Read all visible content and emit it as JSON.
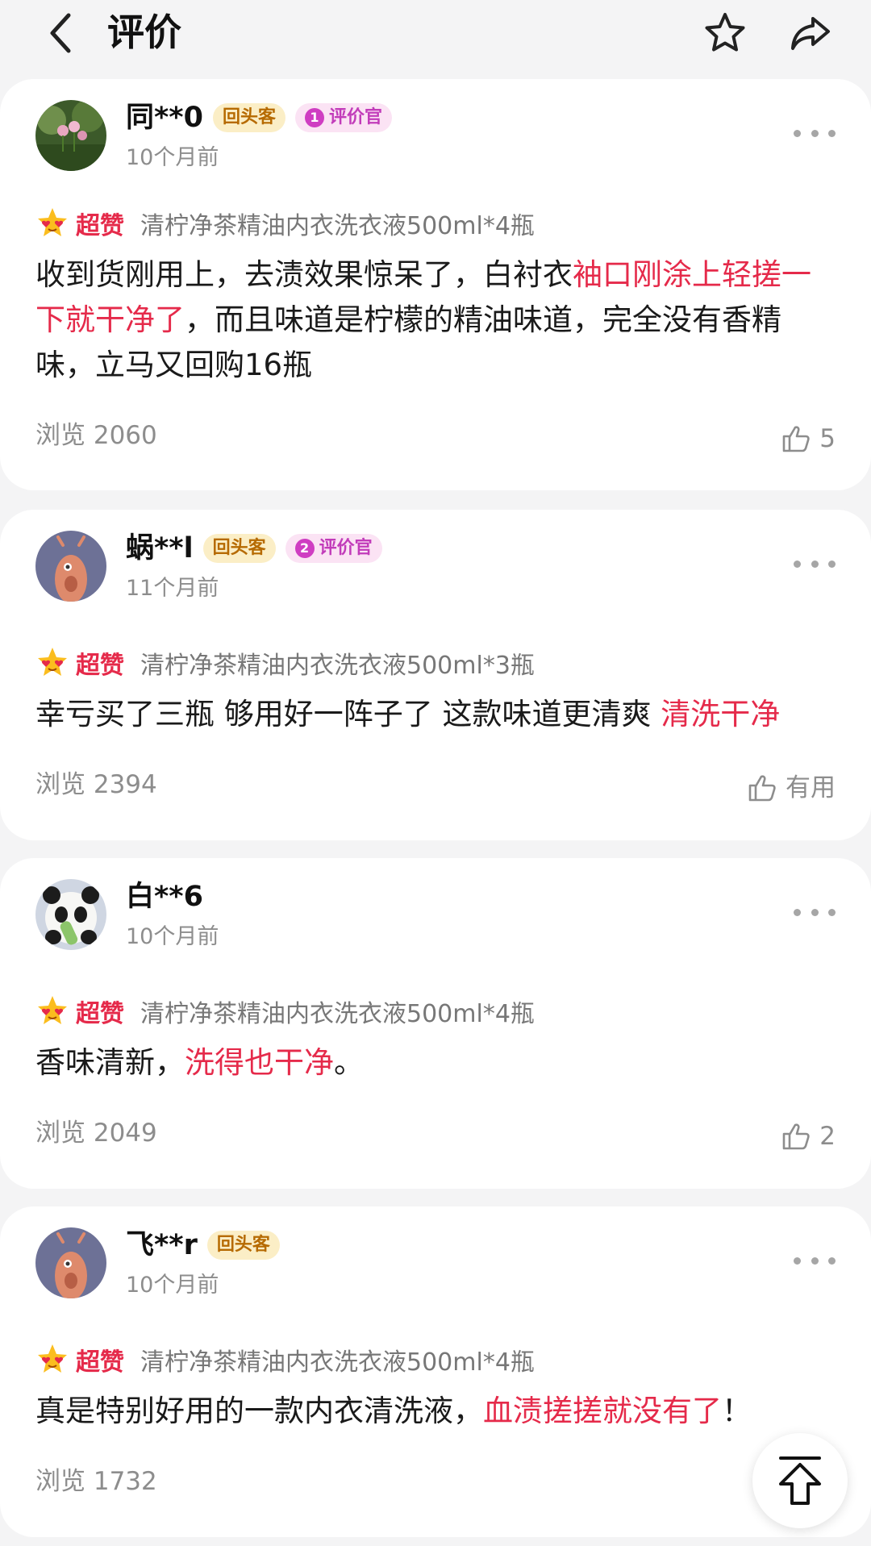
{
  "header": {
    "title": "评价",
    "back_icon": "chevron-left-icon",
    "favorite_icon": "star-icon",
    "share_icon": "share-arrow-icon"
  },
  "colors": {
    "background": "#f4f4f5",
    "highlight": "#e52a4a",
    "secondary_text": "#8d8d8d"
  },
  "reviews": [
    {
      "username": "同**0",
      "badges": {
        "returning": "回头客",
        "reviewer": "评价官",
        "reviewer_level": "1"
      },
      "time": "10个月前",
      "rating": "超赞",
      "spec": "清柠净茶精油内衣洗衣液500ml*4瓶",
      "text_parts": [
        "收到货刚用上，去渍效果惊呆了，白衬衣",
        "袖口刚涂上轻搓一下就干净了",
        "，而且味道是柠檬的精油味道，完全没有香精味，立马又回购16瓶"
      ],
      "views": "浏览 2060",
      "likes": "5"
    },
    {
      "username": "蜗**l",
      "badges": {
        "returning": "回头客",
        "reviewer": "评价官",
        "reviewer_level": "2"
      },
      "time": "11个月前",
      "rating": "超赞",
      "spec": "清柠净茶精油内衣洗衣液500ml*3瓶",
      "text_parts": [
        "幸亏买了三瓶 够用好一阵子了 这款味道更清爽 ",
        "清洗干净",
        ""
      ],
      "views": "浏览 2394",
      "likes": "有用"
    },
    {
      "username": "白**6",
      "time": "10个月前",
      "rating": "超赞",
      "spec": "清柠净茶精油内衣洗衣液500ml*4瓶",
      "text_parts": [
        "香味清新，",
        "洗得也干净",
        "。"
      ],
      "views": "浏览 2049",
      "likes": "2"
    },
    {
      "username": "飞**r",
      "badges": {
        "returning": "回头客"
      },
      "time": "10个月前",
      "rating": "超赞",
      "spec": "清柠净茶精油内衣洗衣液500ml*4瓶",
      "text_parts": [
        "真是特别好用的一款内衣清洗液，",
        "血渍搓搓就没有了",
        "！"
      ],
      "views": "浏览 1732"
    }
  ],
  "scroll_top_icon": "scroll-to-top-icon"
}
